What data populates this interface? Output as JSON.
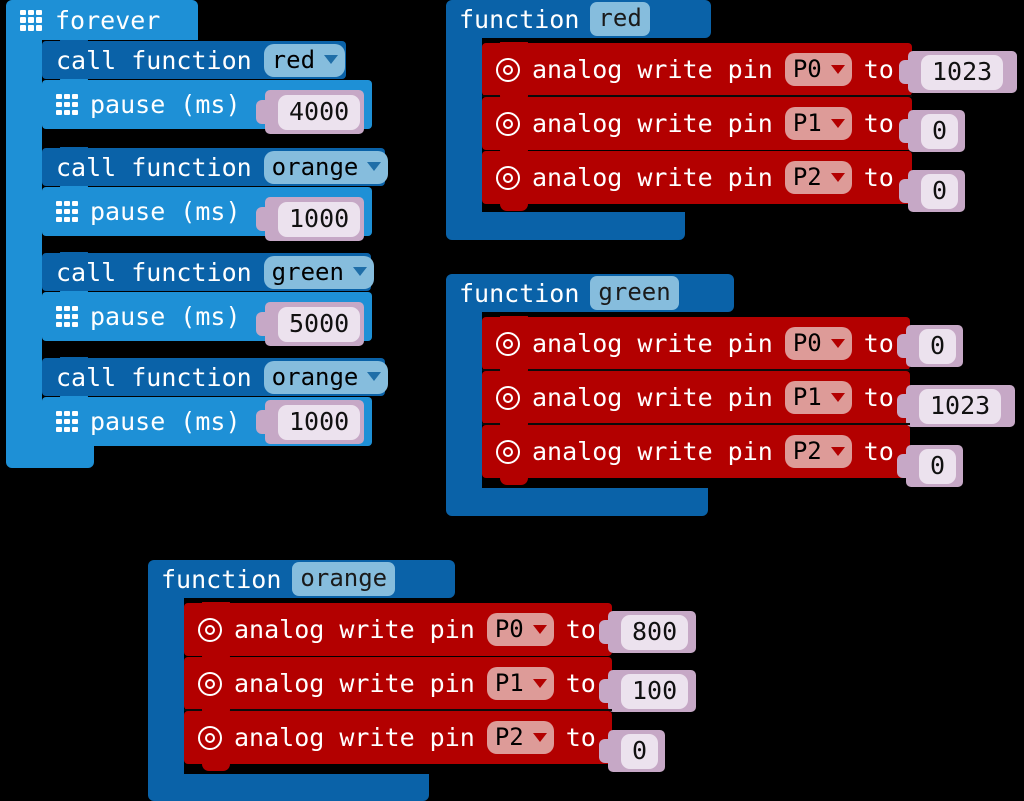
{
  "palette": {
    "background": "#000000",
    "loop_blue": "#1e90d6",
    "function_blue": "#0a62a8",
    "pins_red": "#b30000",
    "dropdown_blue": "#86bddd",
    "dropdown_red": "#dd9b98",
    "number_shadow": "#c6a8c6",
    "number_field": "#ece2ee",
    "text_white": "#ffffff"
  },
  "icons": {
    "grid": "grid-3x3-icon",
    "target": "target-icon",
    "caret": "chevron-down-icon"
  },
  "forever_loop": {
    "label": "forever",
    "statements": [
      {
        "kind": "call",
        "prefix": "call function",
        "value": "red"
      },
      {
        "kind": "pause",
        "label": "pause (ms)",
        "value": "4000"
      },
      {
        "kind": "call",
        "prefix": "call function",
        "value": "orange"
      },
      {
        "kind": "pause",
        "label": "pause (ms)",
        "value": "1000"
      },
      {
        "kind": "call",
        "prefix": "call function",
        "value": "green"
      },
      {
        "kind": "pause",
        "label": "pause (ms)",
        "value": "5000"
      },
      {
        "kind": "call",
        "prefix": "call function",
        "value": "orange"
      },
      {
        "kind": "pause",
        "label": "pause (ms)",
        "value": "1000"
      }
    ]
  },
  "functions": [
    {
      "keyword": "function",
      "name": "red",
      "statements": [
        {
          "prefix": "analog write pin",
          "pin": "P0",
          "mid": "to",
          "value": "1023"
        },
        {
          "prefix": "analog write pin",
          "pin": "P1",
          "mid": "to",
          "value": "0"
        },
        {
          "prefix": "analog write pin",
          "pin": "P2",
          "mid": "to",
          "value": "0"
        }
      ]
    },
    {
      "keyword": "function",
      "name": "green",
      "statements": [
        {
          "prefix": "analog write pin",
          "pin": "P0",
          "mid": "to",
          "value": "0"
        },
        {
          "prefix": "analog write pin",
          "pin": "P1",
          "mid": "to",
          "value": "1023"
        },
        {
          "prefix": "analog write pin",
          "pin": "P2",
          "mid": "to",
          "value": "0"
        }
      ]
    },
    {
      "keyword": "function",
      "name": "orange",
      "statements": [
        {
          "prefix": "analog write pin",
          "pin": "P0",
          "mid": "to",
          "value": "800"
        },
        {
          "prefix": "analog write pin",
          "pin": "P1",
          "mid": "to",
          "value": "100"
        },
        {
          "prefix": "analog write pin",
          "pin": "P2",
          "mid": "to",
          "value": "0"
        }
      ]
    }
  ]
}
